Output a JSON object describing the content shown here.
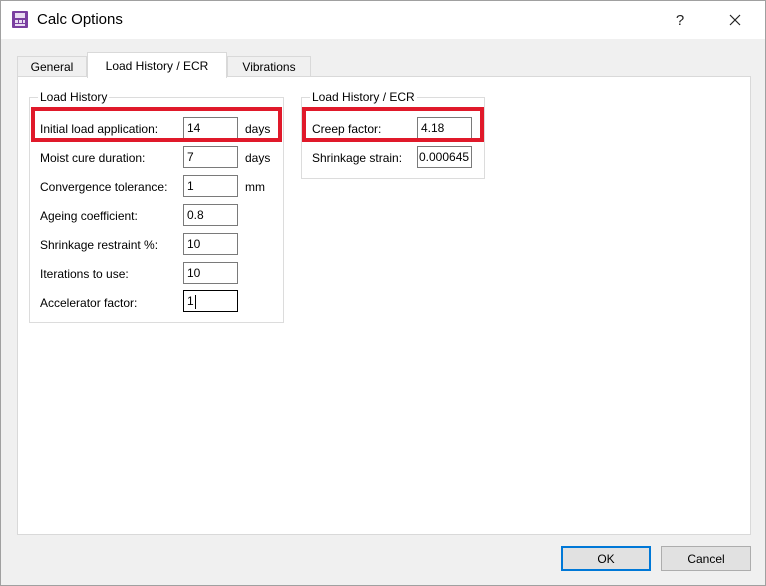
{
  "window": {
    "title": "Calc Options",
    "help_glyph": "?",
    "app_icon": "app-icon",
    "accent": "#0078d7",
    "highlight_color": "#e0192a"
  },
  "tabs": [
    {
      "label": "General",
      "active": false
    },
    {
      "label": "Load History / ECR",
      "active": true
    },
    {
      "label": "Vibrations",
      "active": false
    }
  ],
  "load_history": {
    "legend": "Load History",
    "rows": [
      {
        "label": "Initial load application:",
        "value": "14",
        "unit": "days"
      },
      {
        "label": "Moist cure duration:",
        "value": "7",
        "unit": "days"
      },
      {
        "label": "Convergence tolerance:",
        "value": "1",
        "unit": "mm"
      },
      {
        "label": "Ageing coefficient:",
        "value": "0.8",
        "unit": ""
      },
      {
        "label": "Shrinkage restraint %:",
        "value": "10",
        "unit": ""
      },
      {
        "label": "Iterations to use:",
        "value": "10",
        "unit": ""
      },
      {
        "label": "Accelerator factor:",
        "value": "1",
        "unit": ""
      }
    ]
  },
  "ecr": {
    "legend": "Load History / ECR",
    "rows": [
      {
        "label": "Creep factor:",
        "value": "4.18"
      },
      {
        "label": "Shrinkage strain:",
        "value": "0.000645"
      }
    ]
  },
  "buttons": {
    "ok": "OK",
    "cancel": "Cancel"
  }
}
